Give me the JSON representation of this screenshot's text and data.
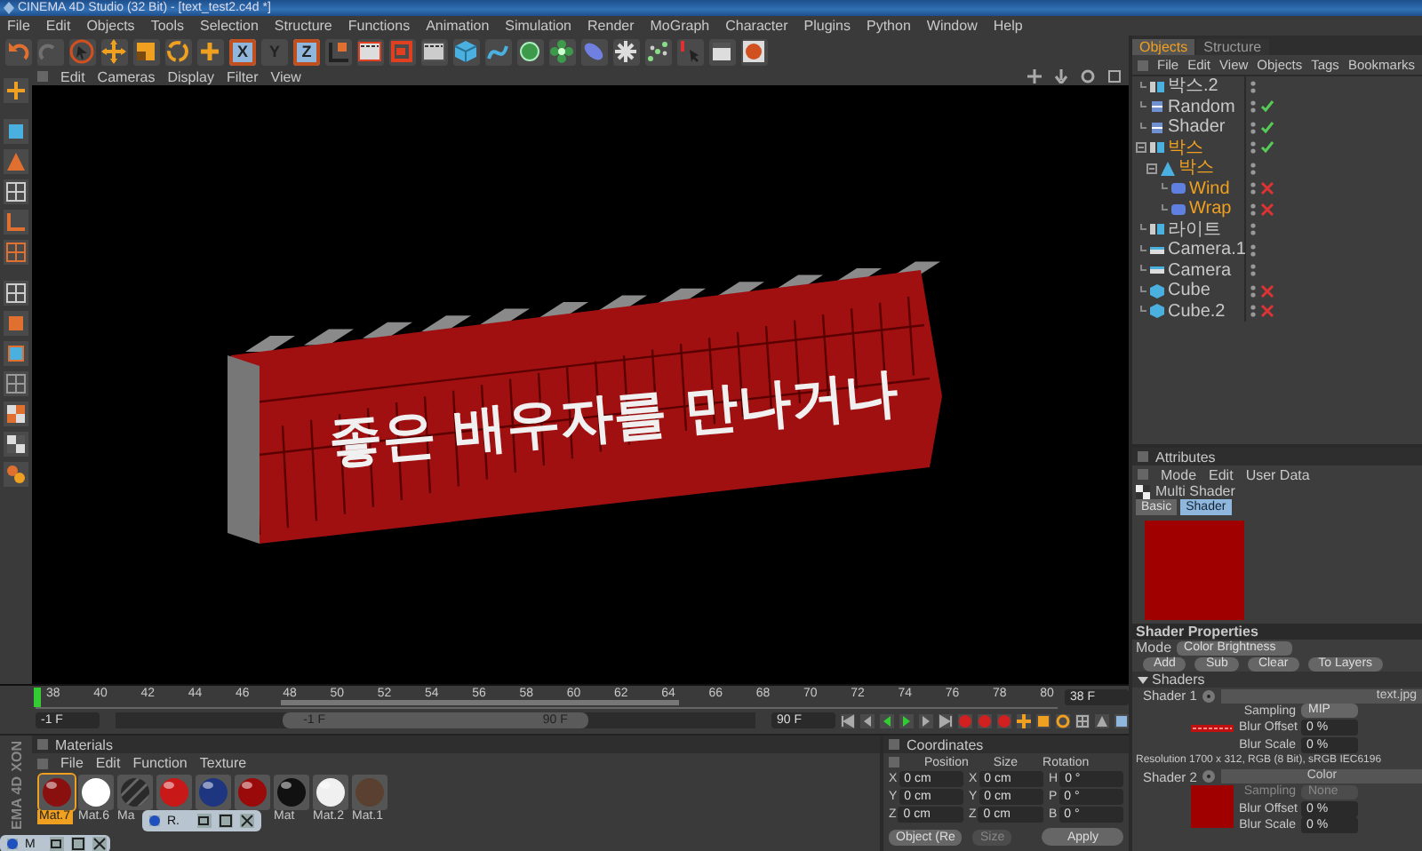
{
  "window": {
    "title": "CINEMA 4D Studio (32 Bit) - [text_test2.c4d *]"
  },
  "menu": [
    "File",
    "Edit",
    "Objects",
    "Tools",
    "Selection",
    "Structure",
    "Functions",
    "Animation",
    "Simulation",
    "Render",
    "MoGraph",
    "Character",
    "Plugins",
    "Python",
    "Window",
    "Help"
  ],
  "toolbar": {
    "axis_labels": [
      {
        "label": "X",
        "selected": true
      },
      {
        "label": "Y",
        "selected": false
      },
      {
        "label": "Z",
        "selected": true
      }
    ]
  },
  "viewport": {
    "menu": [
      "Edit",
      "Cameras",
      "Display",
      "Filter",
      "View"
    ],
    "scene_text": "좋은 배우자를 만나거나"
  },
  "timeline": {
    "range_slider": {
      "level": 0.48
    },
    "ticks": [
      "38",
      "40",
      "42",
      "44",
      "46",
      "48",
      "50",
      "52",
      "54",
      "56",
      "58",
      "60",
      "62",
      "64",
      "66",
      "68",
      "70",
      "72",
      "74",
      "76",
      "78",
      "80"
    ],
    "playhead": {
      "level": 0
    },
    "current_frame": "38 F",
    "start_field": "-1 F",
    "range_start": "-1 F",
    "range_end": "90 F",
    "end_field": "90 F"
  },
  "logo": [
    "XON",
    "EMA 4D"
  ],
  "materials": {
    "title": "Materials",
    "menu": [
      "File",
      "Edit",
      "Function",
      "Texture"
    ],
    "items": [
      {
        "label": "Mat.7",
        "color": "#8a1010",
        "kind": "glossy",
        "selected": true
      },
      {
        "label": "Mat.6",
        "color": "#ffffff",
        "kind": "glossy",
        "selected": false
      },
      {
        "label": "Ma",
        "color": "#2a2a2a",
        "kind": "striped",
        "selected": false
      },
      {
        "color": "#c81818",
        "kind": "glossy",
        "selected": false
      },
      {
        "color": "#1e3580",
        "kind": "glossy",
        "selected": false
      },
      {
        "color": "#9a0a0a",
        "kind": "glossy",
        "selected": false
      },
      {
        "label": "Mat",
        "color": "#111111",
        "kind": "glossy",
        "selected": false
      },
      {
        "label": "Mat.2",
        "color": "#f0f0f0",
        "kind": "glossy",
        "selected": false
      },
      {
        "label": "Mat.1",
        "color": "#5a4030",
        "kind": "photo",
        "selected": false
      }
    ]
  },
  "minimized_windows": [
    {
      "label": "R."
    },
    {
      "label": "M"
    }
  ],
  "coordinates": {
    "title": "Coordinates",
    "columns": [
      "Position",
      "Size",
      "Rotation"
    ],
    "rows": [
      {
        "axes": [
          "X",
          "X",
          "H"
        ],
        "values": [
          "0 cm",
          "0 cm",
          "0 °"
        ]
      },
      {
        "axes": [
          "Y",
          "Y",
          "P"
        ],
        "values": [
          "0 cm",
          "0 cm",
          "0 °"
        ]
      },
      {
        "axes": [
          "Z",
          "Z",
          "B"
        ],
        "values": [
          "0 cm",
          "0 cm",
          "0 °"
        ]
      }
    ],
    "mode": "Object (Re",
    "size_mode": {
      "label": "Size",
      "disabled": true
    },
    "apply": "Apply"
  },
  "objects": {
    "tabs": [
      {
        "label": "Objects",
        "selected": true
      },
      {
        "label": "Structure",
        "selected": false
      }
    ],
    "menu": [
      "File",
      "Edit",
      "View",
      "Objects",
      "Tags",
      "Bookmarks"
    ],
    "tree": [
      {
        "name": "박스.2",
        "kind": "cloner",
        "selected": false
      },
      {
        "name": "Random",
        "kind": "effector",
        "enabled": true,
        "selected": false
      },
      {
        "name": "Shader",
        "kind": "effector",
        "enabled": true,
        "selected": false
      },
      {
        "name": "박스",
        "kind": "cloner",
        "enabled": true,
        "selected": true,
        "children": [
          {
            "name": "박스",
            "kind": "primitive",
            "selected": true,
            "children": [
              {
                "name": "Wind",
                "kind": "deformer",
                "enabled": false,
                "selected": true
              },
              {
                "name": "Wrap",
                "kind": "deformer",
                "enabled": false,
                "selected": true
              }
            ]
          }
        ]
      },
      {
        "name": "라이트",
        "kind": "null",
        "selected": false
      },
      {
        "name": "Camera.1",
        "kind": "camera",
        "selected": false
      },
      {
        "name": "Camera",
        "kind": "camera",
        "selected": false
      },
      {
        "name": "Cube",
        "kind": "cube",
        "enabled": false,
        "selected": false
      },
      {
        "name": "Cube.2",
        "kind": "cube",
        "enabled": false,
        "selected": false
      }
    ]
  },
  "attributes": {
    "title": "Attributes",
    "menu": [
      "Mode",
      "Edit",
      "User Data"
    ],
    "object": "Multi Shader",
    "tabs": [
      {
        "label": "Basic",
        "selected": false
      },
      {
        "label": "Shader",
        "selected": true
      }
    ],
    "section": "Shader Properties",
    "mode_label": "Mode",
    "mode_value": "Color Brightness",
    "buttons": [
      "Add",
      "Sub",
      "Clear",
      "To Layers"
    ],
    "group": "Shaders",
    "shaders": [
      {
        "label": "Shader 1",
        "field": "text.jpg",
        "kind": "bitmap",
        "params": [
          {
            "label": "Sampling",
            "value": "MIP",
            "kind": "dropdown",
            "disabled": false
          },
          {
            "label": "Blur Offset",
            "value": "0 %",
            "kind": "number",
            "disabled": false
          },
          {
            "label": "Blur Scale",
            "value": "0 %",
            "kind": "number",
            "disabled": false
          }
        ],
        "resolution": "Resolution 1700 x 312, RGB (8 Bit), sRGB IEC6196"
      },
      {
        "label": "Shader 2",
        "field": "Color",
        "kind": "color",
        "params": [
          {
            "label": "Sampling",
            "value": "None",
            "kind": "dropdown",
            "disabled": true
          },
          {
            "label": "Blur Offset",
            "value": "0 %",
            "kind": "number",
            "disabled": false
          },
          {
            "label": "Blur Scale",
            "value": "0 %",
            "kind": "number",
            "disabled": false
          }
        ]
      }
    ]
  }
}
